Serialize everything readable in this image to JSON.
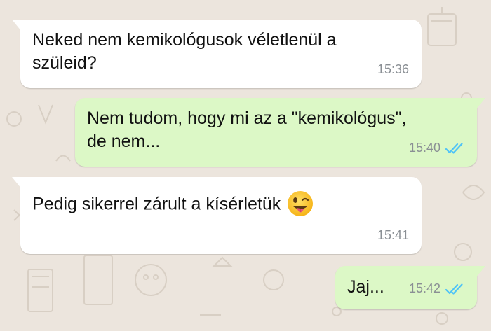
{
  "colors": {
    "background": "#ece5dd",
    "incoming_bubble": "#ffffff",
    "outgoing_bubble": "#dcf8c6",
    "timestamp": "#8a8f94",
    "read_ticks": "#4fc3f7"
  },
  "messages": [
    {
      "direction": "incoming",
      "text": "Neked nem kemikológusok véletlenül a\nszüleid?",
      "time": "15:36"
    },
    {
      "direction": "outgoing",
      "text": "Nem tudom, hogy mi az a \"kemikológus\",\nde nem...",
      "time": "15:40",
      "status_icon": "double-check-read-icon"
    },
    {
      "direction": "incoming",
      "text": "Pedig sikerrel zárult a kísérletük",
      "emoji": "winking-face-with-tongue-emoji",
      "time": "15:41"
    },
    {
      "direction": "outgoing",
      "text": "Jaj...",
      "time": "15:42",
      "status_icon": "double-check-read-icon"
    }
  ]
}
